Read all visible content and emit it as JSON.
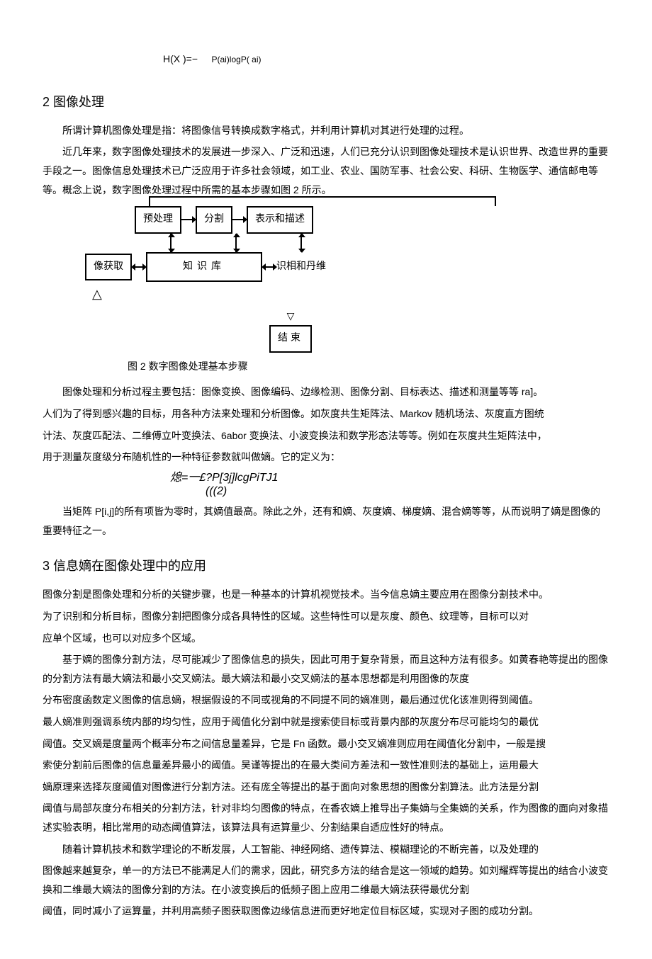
{
  "formula1": {
    "left": "H(X )=−",
    "right": "P(ai)logP( ai)"
  },
  "section2": {
    "heading": "2 图像处理",
    "p1": "所谓计算机图像处理是指：将图像信号转换成数字格式，并利用计算机对其进行处理的过程。",
    "p2": "近几年来，数字图像处理技术的发展进一步深入、广泛和迅速，人们已充分认识到图像处理技术是认识世界、改造世界的重要手段之一。图像信息处理技术已广泛应用于许多社会领域，如工业、农业、国防军事、社会公安、科研、生物医学、通信邮电等等。概念上说，数字图像处理过程中所需的基本步骤如图 2 所示。"
  },
  "diagram": {
    "preproc": "预处理",
    "segment": "分割",
    "represent": "表示和描述",
    "acquire": "像获取",
    "knowledge": "知识库",
    "recognize": "识相和丹维",
    "end": "结束",
    "caption": "图 2 数字图像处理基本步骤"
  },
  "section2b": {
    "p3": "图像处理和分析过程主要包括：图像变换、图像编码、边缘检测、图像分割、目标表达、描述和测量等等 ra]。",
    "p4": "人们为了得到感兴趣的目标，用各种方法来处理和分析图像。如灰度共生矩阵法、Markov 随机场法、灰度直方图统",
    "p5": "计法、灰度匹配法、二维傅立叶变换法、6abor 变换法、小波变换法和数学形态法等等。例如在灰度共生矩阵法中，",
    "p6": "用于测量灰度级分布随机性的一种特征参数就叫做嫡。它的定义为：",
    "formula2_line1": "熄=一£?P[3j]lcgPiTJ1",
    "formula2_line2": "(((2)",
    "p7": "当矩阵 P[i,j]的所有项皆为零时，其嫡值最高。除此之外，还有和嫡、灰度嫡、梯度嫡、混合嫡等等，从而说明了嫡是图像的重要特征之一。"
  },
  "section3": {
    "heading": "3 信息嫡在图像处理中的应用",
    "p1": "图像分割是图像处理和分析的关键步骤，也是一种基本的计算机视觉技术。当今信息嫡主要应用在图像分割技术中。",
    "p2": "为了识别和分析目标，图像分割把图像分成各具特性的区域。这些特性可以是灰度、颜色、纹理等，目标可以对",
    "p3": "应单个区域，也可以对应多个区域。",
    "p4": "基于嫡的图像分割方法，尽可能减少了图像信息的损失，因此可用于复杂背景，而且这种方法有很多。如黄春艳等提出的图像的分割方法有最大嫡法和最小交叉嫡法。最大嫡法和最小交叉嫡法的基本思想都是利用图像的灰度",
    "p5": "分布密度函数定义图像的信息嫡，根据假设的不同或视角的不同提不同的嫡准则，最后通过优化该准则得到阈值。",
    "p6": "最人嫡准则强调系统内部的均匀性，应用于阈值化分割中就是搜索使目标或背景内部的灰度分布尽可能均匀的最优",
    "p7": "阈值。交叉嫡是度量两个概率分布之间信息量差异，它是 Fn 函数。最小交叉嫡准则应用在阈值化分割中，一般是搜",
    "p8": "索使分割前后图像的信息量差异最小的阈值。吴谨等提出的在最大类间方差法和一致性准则法的基础上，运用最大",
    "p9": "嫡原理来选择灰度阈值对图像进行分割方法。还有庞全等提出的基于面向对象思想的图像分割算法。此方法是分割",
    "p10": "阈值与局部灰度分布相关的分割方法，针对非均匀图像的特点，在香农嫡上推导出子集嫡与全集嫡的关系，作为图像的面向对象描述实验表明，相比常用的动态阈值算法，该算法具有运算量少、分割结果自适应性好的特点。",
    "p11": "随着计算机技术和数学理论的不断发展，人工智能、神经网络、遗传算法、模糊理论的不断完善，以及处理的",
    "p12": "图像越来越复杂，单一的方法已不能满足人们的需求，因此，研究多方法的结合是这一领域的趋势。如刘耀辉等提出的结合小波变换和二维最大嫡法的图像分割的方法。在小波变换后的低频子图上应用二维最大嫡法获得最优分割",
    "p13": "阈值，同时减小了运算量，并利用高频子图获取图像边缘信息进而更好地定位目标区域，实现对子图的成功分割。"
  }
}
